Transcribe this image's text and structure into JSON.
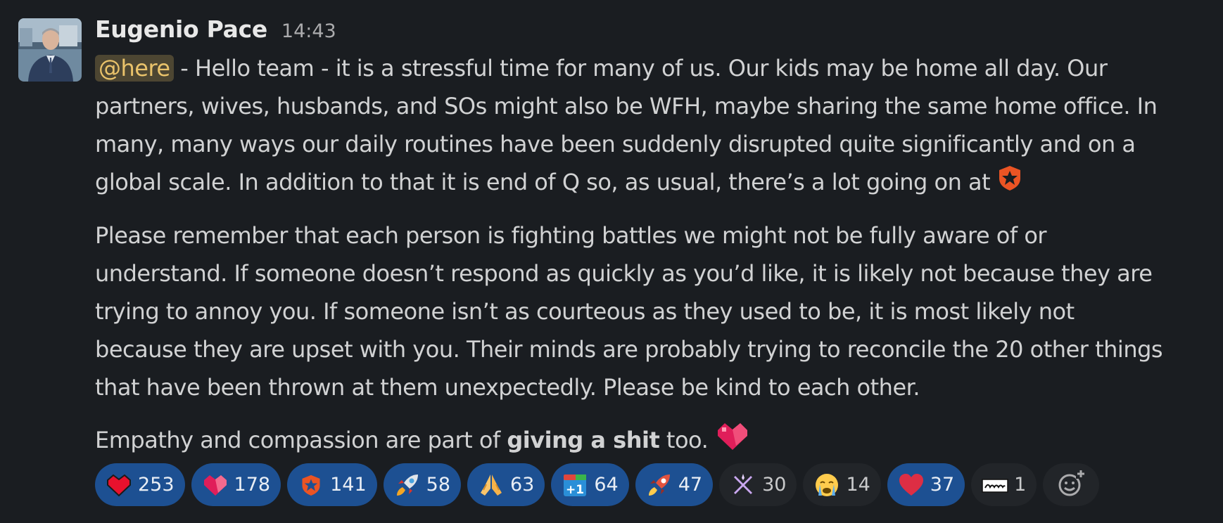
{
  "message": {
    "author": "Eugenio Pace",
    "time": "14:43",
    "mention": "@here",
    "paragraph1_lines": [
      " - Hello team - it is a stressful time for many of us. Our kids may be home all day. Our",
      "partners, wives, husbands, and SOs might also be WFH, maybe sharing the same home office. In",
      "many, many ways our daily routines have been suddenly disrupted quite significantly and on a",
      "global scale. In addition to that it is end of Q so, as usual, there’s a lot going on at"
    ],
    "paragraph2_lines": [
      "Please remember that each person is fighting battles we might not be fully aware of or",
      "understand. If someone doesn’t respond as quickly as you’d like, it is likely not because they are",
      "trying to annoy you. If someone isn’t as courteous as they used to be, it is most likely not",
      "because they are upset with you. Their minds are probably trying to reconcile the 20 other things",
      "that have been thrown at them unexpectedly. Please be kind to each other."
    ],
    "paragraph3": {
      "before": "Empathy and compassion are part of ",
      "bold": "giving a shit",
      "after": " too."
    },
    "inline_emojis": [
      "auth0-icon",
      "pixel-heart-icon"
    ]
  },
  "reactions": [
    {
      "emoji": "pixel-red-heart",
      "count": "253",
      "selected": true
    },
    {
      "emoji": "pixel-pink-heart",
      "count": "178",
      "selected": true
    },
    {
      "emoji": "auth0-shield",
      "count": "141",
      "selected": true
    },
    {
      "emoji": "rocket",
      "count": "58",
      "selected": true
    },
    {
      "emoji": "folded-hands",
      "count": "63",
      "selected": true
    },
    {
      "emoji": "plus-one-calendar",
      "count": "64",
      "selected": true
    },
    {
      "emoji": "rocket-red",
      "count": "47",
      "selected": true
    },
    {
      "emoji": "sparkle-x",
      "count": "30",
      "selected": false
    },
    {
      "emoji": "crying-face",
      "count": "14",
      "selected": false
    },
    {
      "emoji": "red-heart",
      "count": "37",
      "selected": true
    },
    {
      "emoji": "thanks-card",
      "count": "1",
      "selected": false
    }
  ],
  "add_reaction": "add-reaction-icon",
  "colors": {
    "background": "#1a1d21",
    "mention_bg": "#4d4632",
    "mention_text": "#eac36b",
    "reaction_selected": "#1d5092",
    "reaction_unselected": "#222529"
  }
}
